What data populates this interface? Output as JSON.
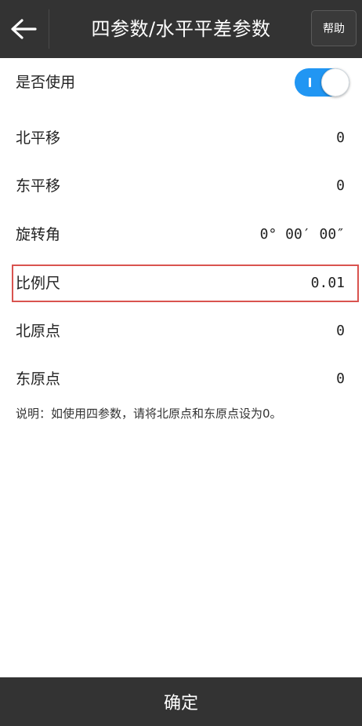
{
  "header": {
    "back_icon": "arrow-left-icon",
    "title": "四参数/水平平差参数",
    "help_label": "帮助"
  },
  "enable": {
    "label": "是否使用",
    "checked": true,
    "accent_color": "#2196f3"
  },
  "fields": [
    {
      "label": "北平移",
      "value": "0"
    },
    {
      "label": "东平移",
      "value": "0"
    },
    {
      "label": "旋转角",
      "value": "0° 00′ 00″"
    },
    {
      "label": "比例尺",
      "value": "0.01"
    },
    {
      "label": "北原点",
      "value": "0"
    },
    {
      "label": "东原点",
      "value": "0"
    }
  ],
  "note": "说明：如使用四参数，请将北原点和东原点设为0。",
  "footer": {
    "confirm_label": "确定"
  },
  "highlight_color": "#d9534f"
}
